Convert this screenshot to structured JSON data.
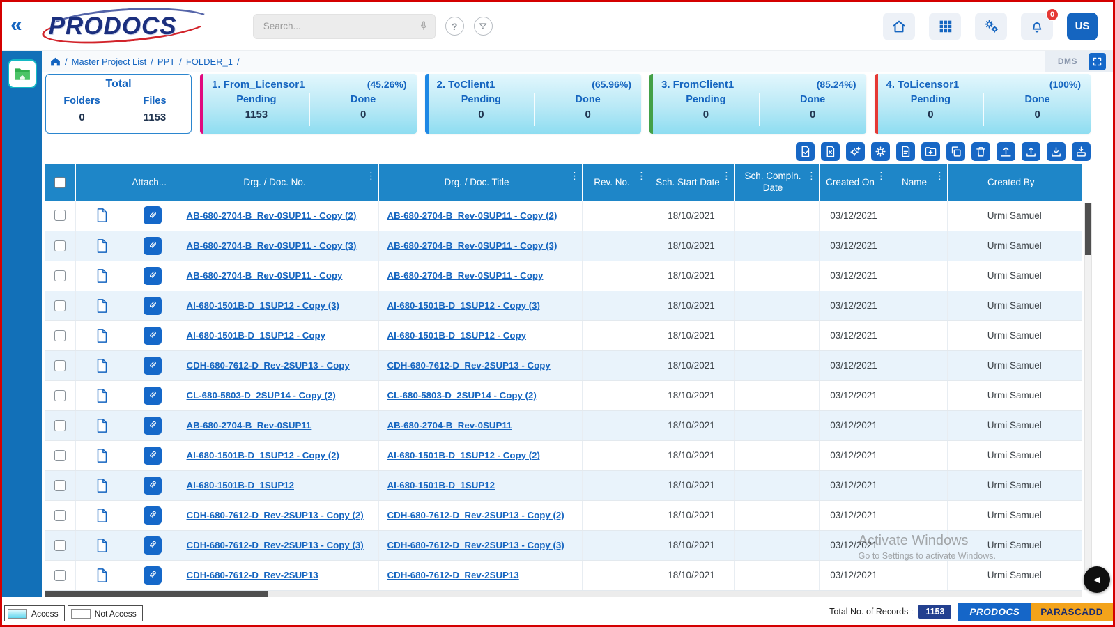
{
  "glyphs": {
    "collapse": "«",
    "kebab": "⋮",
    "help": "?",
    "scroll_left": "◀"
  },
  "header": {
    "logo_text": "PRODOCS",
    "search_placeholder": "Search...",
    "notification_count": "0",
    "avatar_label": "US"
  },
  "breadcrumb": {
    "separator": "/",
    "items": [
      "Master Project List",
      "PPT",
      "FOLDER_1"
    ],
    "dms_label": "DMS"
  },
  "cards": {
    "labels": {
      "pending": "Pending",
      "done": "Done",
      "folders": "Folders",
      "files": "Files"
    },
    "total": {
      "title": "Total",
      "folders": "0",
      "files": "1153"
    },
    "stages": [
      {
        "title": "1. From_Licensor1",
        "percent": "(45.26%)",
        "pending": "1153",
        "done": "0",
        "accent": "#e0097e"
      },
      {
        "title": "2. ToClient1",
        "percent": "(65.96%)",
        "pending": "0",
        "done": "0",
        "accent": "#1e88e5"
      },
      {
        "title": "3. FromClient1",
        "percent": "(85.24%)",
        "pending": "0",
        "done": "0",
        "accent": "#43a047"
      },
      {
        "title": "4. ToLicensor1",
        "percent": "(100%)",
        "pending": "0",
        "done": "0",
        "accent": "#e53935"
      }
    ]
  },
  "toolbar": {
    "icons": [
      "approve-document",
      "reject-document",
      "workflow-gear-add",
      "run-workflow-gear",
      "document-report",
      "add-folder",
      "copy-document",
      "delete-trash",
      "move-up-box",
      "upload",
      "download",
      "export-down"
    ]
  },
  "table": {
    "columns": [
      "Attach...",
      "Drg. / Doc. No.",
      "Drg. / Doc. Title",
      "Rev. No.",
      "Sch. Start Date",
      "Sch. Compln. Date",
      "Created On",
      "Name",
      "Created By"
    ],
    "rows": [
      {
        "doc_no": "AB-680-2704-B_Rev-0SUP11 - Copy (2)",
        "title": "AB-680-2704-B_Rev-0SUP11 - Copy (2)",
        "rev": "",
        "start": "18/10/2021",
        "compln": "",
        "created_on": "03/12/2021",
        "name": "",
        "created_by": "Urmi Samuel"
      },
      {
        "doc_no": "AB-680-2704-B_Rev-0SUP11 - Copy (3)",
        "title": "AB-680-2704-B_Rev-0SUP11 - Copy (3)",
        "rev": "",
        "start": "18/10/2021",
        "compln": "",
        "created_on": "03/12/2021",
        "name": "",
        "created_by": "Urmi Samuel"
      },
      {
        "doc_no": "AB-680-2704-B_Rev-0SUP11 - Copy",
        "title": "AB-680-2704-B_Rev-0SUP11 - Copy",
        "rev": "",
        "start": "18/10/2021",
        "compln": "",
        "created_on": "03/12/2021",
        "name": "",
        "created_by": "Urmi Samuel"
      },
      {
        "doc_no": "AI-680-1501B-D_1SUP12 - Copy (3)",
        "title": "AI-680-1501B-D_1SUP12 - Copy (3)",
        "rev": "",
        "start": "18/10/2021",
        "compln": "",
        "created_on": "03/12/2021",
        "name": "",
        "created_by": "Urmi Samuel"
      },
      {
        "doc_no": "AI-680-1501B-D_1SUP12 - Copy",
        "title": "AI-680-1501B-D_1SUP12 - Copy",
        "rev": "",
        "start": "18/10/2021",
        "compln": "",
        "created_on": "03/12/2021",
        "name": "",
        "created_by": "Urmi Samuel"
      },
      {
        "doc_no": "CDH-680-7612-D_Rev-2SUP13 - Copy",
        "title": "CDH-680-7612-D_Rev-2SUP13 - Copy",
        "rev": "",
        "start": "18/10/2021",
        "compln": "",
        "created_on": "03/12/2021",
        "name": "",
        "created_by": "Urmi Samuel"
      },
      {
        "doc_no": "CL-680-5803-D_2SUP14 - Copy (2)",
        "title": "CL-680-5803-D_2SUP14 - Copy (2)",
        "rev": "",
        "start": "18/10/2021",
        "compln": "",
        "created_on": "03/12/2021",
        "name": "",
        "created_by": "Urmi Samuel"
      },
      {
        "doc_no": "AB-680-2704-B_Rev-0SUP11",
        "title": "AB-680-2704-B_Rev-0SUP11",
        "rev": "",
        "start": "18/10/2021",
        "compln": "",
        "created_on": "03/12/2021",
        "name": "",
        "created_by": "Urmi Samuel"
      },
      {
        "doc_no": "AI-680-1501B-D_1SUP12 - Copy (2)",
        "title": "AI-680-1501B-D_1SUP12 - Copy (2)",
        "rev": "",
        "start": "18/10/2021",
        "compln": "",
        "created_on": "03/12/2021",
        "name": "",
        "created_by": "Urmi Samuel"
      },
      {
        "doc_no": "AI-680-1501B-D_1SUP12",
        "title": "AI-680-1501B-D_1SUP12",
        "rev": "",
        "start": "18/10/2021",
        "compln": "",
        "created_on": "03/12/2021",
        "name": "",
        "created_by": "Urmi Samuel"
      },
      {
        "doc_no": "CDH-680-7612-D_Rev-2SUP13 - Copy (2)",
        "title": "CDH-680-7612-D_Rev-2SUP13 - Copy (2)",
        "rev": "",
        "start": "18/10/2021",
        "compln": "",
        "created_on": "03/12/2021",
        "name": "",
        "created_by": "Urmi Samuel"
      },
      {
        "doc_no": "CDH-680-7612-D_Rev-2SUP13 - Copy (3)",
        "title": "CDH-680-7612-D_Rev-2SUP13 - Copy (3)",
        "rev": "",
        "start": "18/10/2021",
        "compln": "",
        "created_on": "03/12/2021",
        "name": "",
        "created_by": "Urmi Samuel"
      },
      {
        "doc_no": "CDH-680-7612-D_Rev-2SUP13",
        "title": "CDH-680-7612-D_Rev-2SUP13",
        "rev": "",
        "start": "18/10/2021",
        "compln": "",
        "created_on": "03/12/2021",
        "name": "",
        "created_by": "Urmi Samuel"
      }
    ]
  },
  "watermark": {
    "line1": "Activate Windows",
    "line2": "Go to Settings to activate Windows."
  },
  "footer": {
    "access": "Access",
    "not_access": "Not Access",
    "total_label": "Total No. of Records :",
    "total_value": "1153",
    "brand_left": "PRODOCS",
    "brand_right": "PARASCADD"
  }
}
